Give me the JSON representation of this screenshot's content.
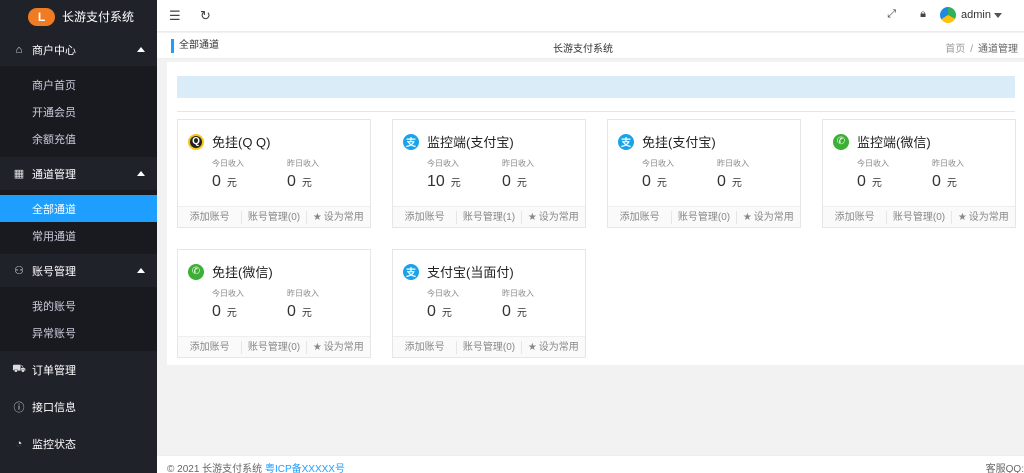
{
  "app": {
    "logo_text": "长游支付系统",
    "logo_mark": "L"
  },
  "sidebar": {
    "groups": [
      {
        "icon": "⌂",
        "icon_name": "home-icon",
        "title": "商户中心",
        "items": [
          "商户首页",
          "开通会员",
          "余额充值"
        ]
      },
      {
        "icon": "▦",
        "icon_name": "channel-icon",
        "title": "通道管理",
        "items": [
          "全部通道",
          "常用通道"
        ]
      },
      {
        "icon": "⚇",
        "icon_name": "user-icon",
        "title": "账号管理",
        "items": [
          "我的账号",
          "异常账号"
        ]
      }
    ],
    "plain": [
      {
        "icon": "⛟",
        "icon_name": "cart-icon",
        "title": "订单管理"
      },
      {
        "icon": "ⓘ",
        "icon_name": "info-icon",
        "title": "接口信息"
      },
      {
        "icon": "◔",
        "icon_name": "dashboard-icon",
        "title": "监控状态"
      }
    ],
    "active_item": "全部通道"
  },
  "header": {
    "user": "admin"
  },
  "tabbar": {
    "active_tab": "全部通道",
    "center_title": "长游支付系统",
    "crumb_home": "首页",
    "crumb_sep": "/",
    "crumb_current": "通道管理"
  },
  "cards": [
    {
      "icon": "qq",
      "title": "免挂(Q Q)",
      "today_label": "今日收入",
      "today": "0",
      "yesterday_label": "昨日收入",
      "yesterday": "0",
      "unit": "元",
      "add": "添加账号",
      "manage": "账号管理(0)",
      "fav": "设为常用"
    },
    {
      "icon": "ali",
      "title": "监控端(支付宝)",
      "today_label": "今日收入",
      "today": "10",
      "yesterday_label": "昨日收入",
      "yesterday": "0",
      "unit": "元",
      "add": "添加账号",
      "manage": "账号管理(1)",
      "fav": "设为常用"
    },
    {
      "icon": "ali",
      "title": "免挂(支付宝)",
      "today_label": "今日收入",
      "today": "0",
      "yesterday_label": "昨日收入",
      "yesterday": "0",
      "unit": "元",
      "add": "添加账号",
      "manage": "账号管理(0)",
      "fav": "设为常用"
    },
    {
      "icon": "wx",
      "title": "监控端(微信)",
      "today_label": "今日收入",
      "today": "0",
      "yesterday_label": "昨日收入",
      "yesterday": "0",
      "unit": "元",
      "add": "添加账号",
      "manage": "账号管理(0)",
      "fav": "设为常用"
    },
    {
      "icon": "wx",
      "title": "免挂(微信)",
      "today_label": "今日收入",
      "today": "0",
      "yesterday_label": "昨日收入",
      "yesterday": "0",
      "unit": "元",
      "add": "添加账号",
      "manage": "账号管理(0)",
      "fav": "设为常用"
    },
    {
      "icon": "ali",
      "title": "支付宝(当面付)",
      "today_label": "今日收入",
      "today": "0",
      "yesterday_label": "昨日收入",
      "yesterday": "0",
      "unit": "元",
      "add": "添加账号",
      "manage": "账号管理(0)",
      "fav": "设为常用"
    }
  ],
  "footer": {
    "copyright": "© 2021 长游支付系统",
    "icp": "粤ICP备XXXXX号",
    "right": "客服QQ:"
  },
  "colors": {
    "sidebar_bg": "#20222a",
    "active": "#1e9fff",
    "notice_bg": "#d9ecf7"
  }
}
